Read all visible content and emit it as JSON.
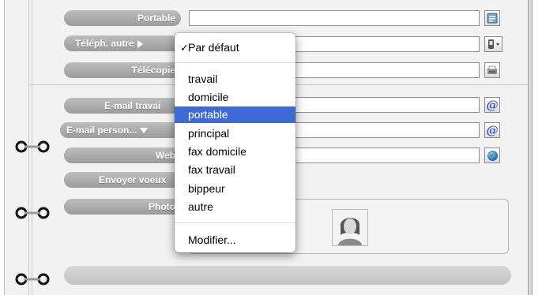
{
  "labels": {
    "portable": "Portable",
    "teleph_autre": "Téléph. autre",
    "telecopie": "Télécopie",
    "email_travail": "E-mail travai",
    "email_perso": "E-mail person...",
    "web": "Web",
    "envoyer_voeux": "Envoyer voeux",
    "photo": "Photo"
  },
  "menu": {
    "default_item": "Par défaut",
    "default_checked": true,
    "items": [
      "travail",
      "domicile",
      "portable",
      "principal",
      "fax domicile",
      "fax travail",
      "bippeur",
      "autre"
    ],
    "selected": "portable",
    "modify": "Modifier..."
  },
  "icons": {
    "portable_action": "address-card-icon",
    "teleph_action": "mobile-phone-menu-icon",
    "fax_action": "fax-icon",
    "email_action": "at-sign-icon",
    "web_action": "globe-icon"
  },
  "colors": {
    "selection": "#3f6ad6",
    "pill": "#a9a9a9",
    "at_sign": "#2f57c9"
  }
}
